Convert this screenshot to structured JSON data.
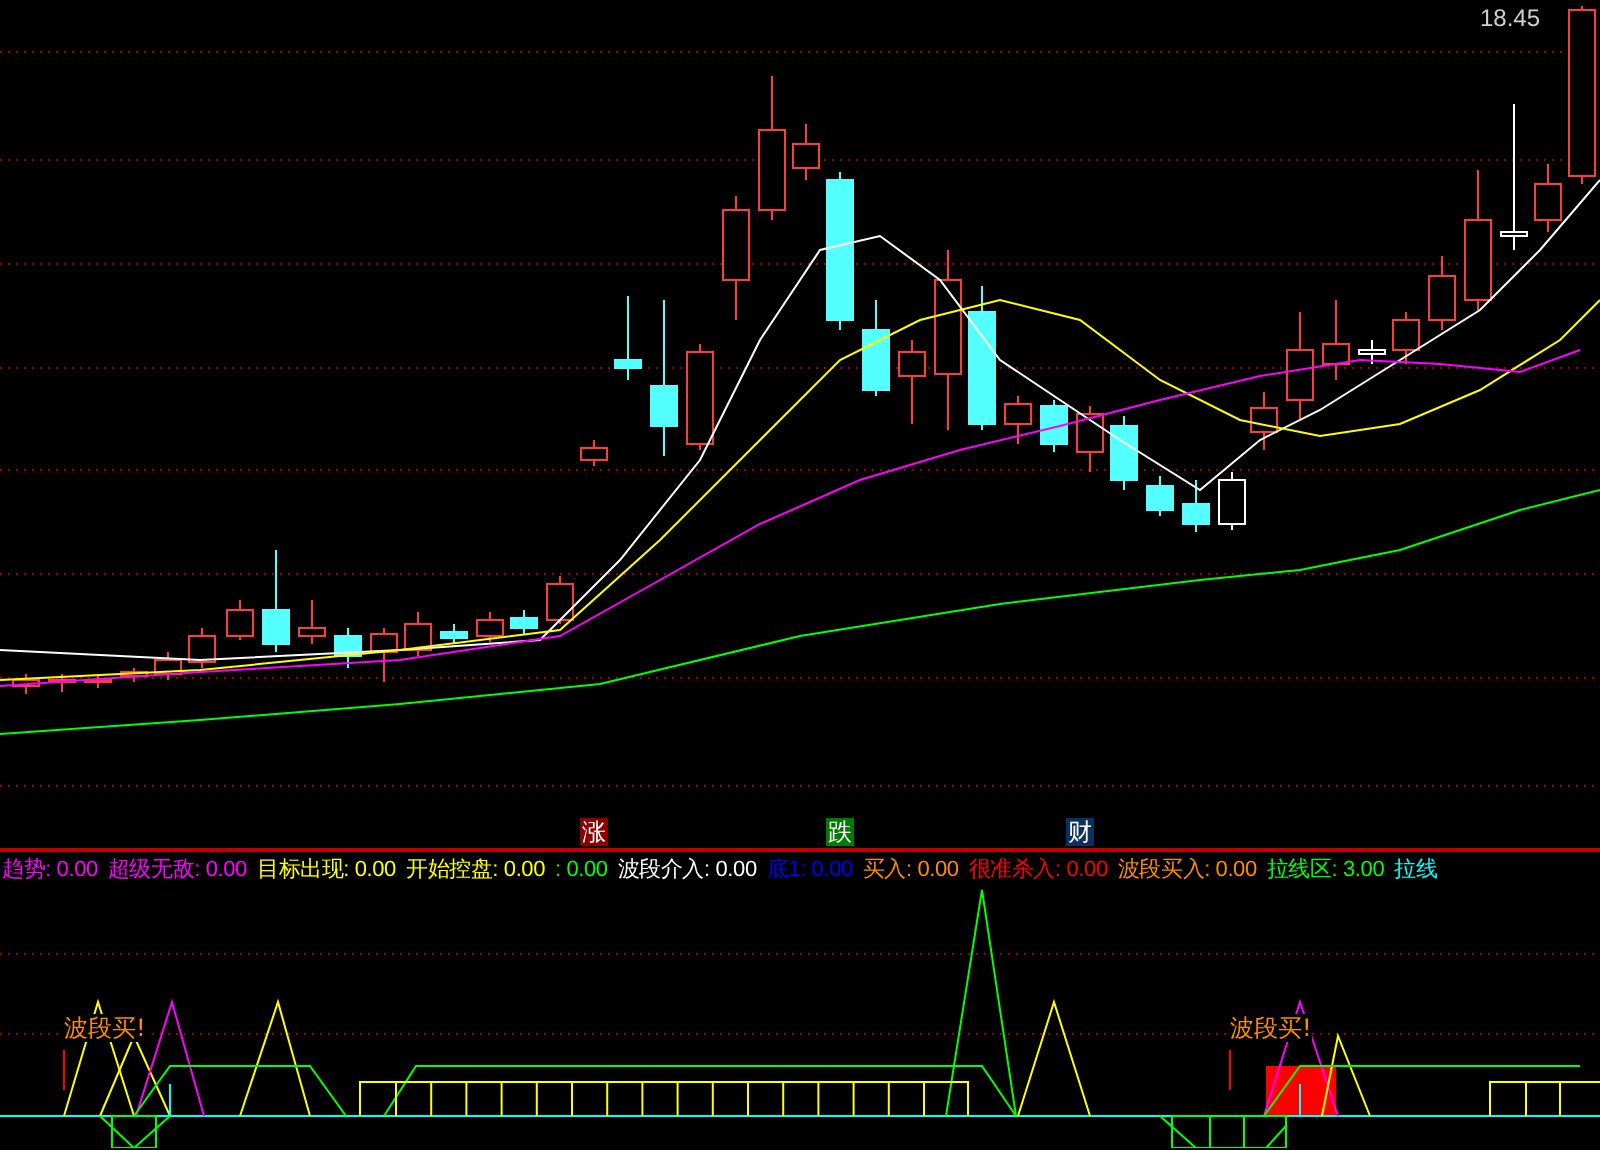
{
  "price_chart": {
    "last_price": "18.45",
    "markers": [
      {
        "text": "涨",
        "color": "#8b0000"
      },
      {
        "text": "跌",
        "color": "#007a00"
      },
      {
        "text": "财",
        "color": "#0a3060"
      }
    ]
  },
  "indicator_legend": [
    {
      "text": "趋势: 0.00",
      "color": "#ff00ff"
    },
    {
      "text": "超级无敌: 0.00",
      "color": "#ff00ff"
    },
    {
      "text": "目标出现: 0.00",
      "color": "#ffff00"
    },
    {
      "text": "开始控盘: 0.00",
      "color": "#ffff00"
    },
    {
      "text": ": 0.00",
      "color": "#00ff00"
    },
    {
      "text": "波段介入: 0.00",
      "color": "#ffffff"
    },
    {
      "text": "底1: 0.00",
      "color": "#0000ff"
    },
    {
      "text": "买入: 0.00",
      "color": "#ff8c00"
    },
    {
      "text": "很准杀入: 0.00",
      "color": "#ff0000"
    },
    {
      "text": "波段买入: 0.00",
      "color": "#ff8c00"
    },
    {
      "text": "拉线区: 3.00",
      "color": "#00ff00"
    },
    {
      "text": "拉线",
      "color": "#00ffff"
    }
  ],
  "indicator_chart": {
    "signals": [
      "波段买!",
      "波段买!"
    ]
  }
}
